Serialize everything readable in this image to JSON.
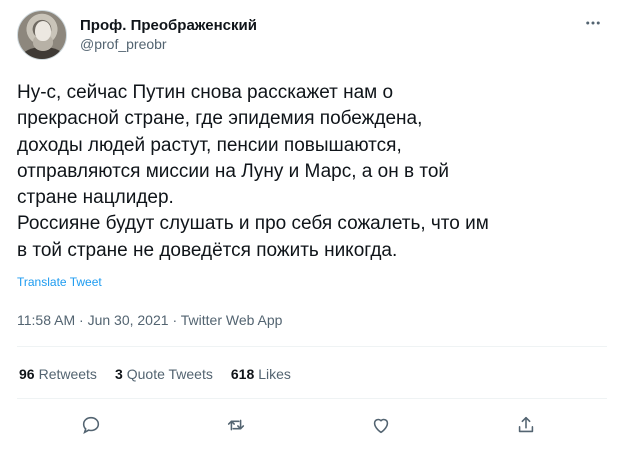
{
  "user": {
    "display_name": "Проф. Преображенский",
    "handle": "@prof_preobr"
  },
  "tweet": {
    "text": "Ну-с, сейчас Путин снова расскажет нам о\nпрекрасной стране, где эпидемия побеждена,\nдоходы людей растут, пенсии повышаются,\nотправляются миссии на Луну и Марс, а он в той\nстране нацлидер.\nРоссияне будут слушать и про себя сожалеть, что им\nв той стране не доведётся пожить никогда.",
    "translate_label": "Translate Tweet",
    "time": "11:58 AM",
    "date": "Jun 30, 2021",
    "source": "Twitter Web App",
    "separator": "·"
  },
  "stats": {
    "retweets_count": "96",
    "retweets_label": "Retweets",
    "quotes_count": "3",
    "quotes_label": "Quote Tweets",
    "likes_count": "618",
    "likes_label": "Likes"
  },
  "icons": {
    "more": "more-icon",
    "reply": "reply-icon",
    "retweet": "retweet-icon",
    "like": "like-icon",
    "share": "share-icon"
  },
  "colors": {
    "text": "#0f1419",
    "secondary": "#536471",
    "link": "#1d9bf0",
    "divider": "#eff3f4"
  }
}
